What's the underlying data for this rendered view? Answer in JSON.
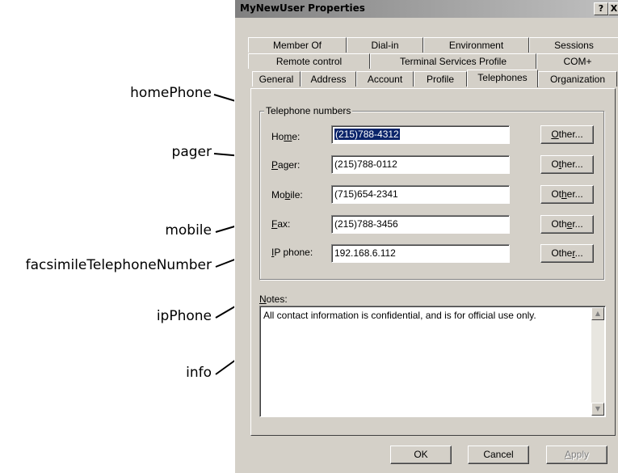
{
  "callouts": {
    "homePhone": "homePhone",
    "pager": "pager",
    "mobile": "mobile",
    "facsimile": "facsimileTelephoneNumber",
    "ipPhone": "ipPhone",
    "info": "info"
  },
  "window": {
    "title": "MyNewUser Properties",
    "help_glyph": "?",
    "close_glyph": "X"
  },
  "tabs": {
    "row1": [
      "Member Of",
      "Dial-in",
      "Environment",
      "Sessions"
    ],
    "row2": [
      "Remote control",
      "Terminal Services Profile",
      "COM+"
    ],
    "row3": [
      "General",
      "Address",
      "Account",
      "Profile",
      "Telephones",
      "Organization"
    ],
    "active": "Telephones"
  },
  "telephone_group": {
    "label": "Telephone numbers",
    "fields": [
      {
        "label_pre": "Ho",
        "label_acc": "m",
        "label_post": "e:",
        "value": "(215)788-4312",
        "selected": true,
        "button_pre": "",
        "button_acc": "O",
        "button_post": "ther..."
      },
      {
        "label_pre": "",
        "label_acc": "P",
        "label_post": "ager:",
        "value": "(215)788-0112",
        "button_pre": "O",
        "button_acc": "t",
        "button_post": "her..."
      },
      {
        "label_pre": "Mo",
        "label_acc": "b",
        "label_post": "ile:",
        "value": "(715)654-2341",
        "button_pre": "Ot",
        "button_acc": "h",
        "button_post": "er..."
      },
      {
        "label_pre": "",
        "label_acc": "F",
        "label_post": "ax:",
        "value": "(215)788-3456",
        "button_pre": "Oth",
        "button_acc": "e",
        "button_post": "r..."
      },
      {
        "label_pre": "",
        "label_acc": "I",
        "label_post": "P phone:",
        "value": "192.168.6.112",
        "button_pre": "Othe",
        "button_acc": "r",
        "button_post": "..."
      }
    ]
  },
  "notes": {
    "label_acc": "N",
    "label_post": "otes:",
    "text": "All contact information is confidential, and is for official use only."
  },
  "buttons": {
    "ok": "OK",
    "cancel": "Cancel",
    "apply_acc": "A",
    "apply_post": "pply"
  }
}
